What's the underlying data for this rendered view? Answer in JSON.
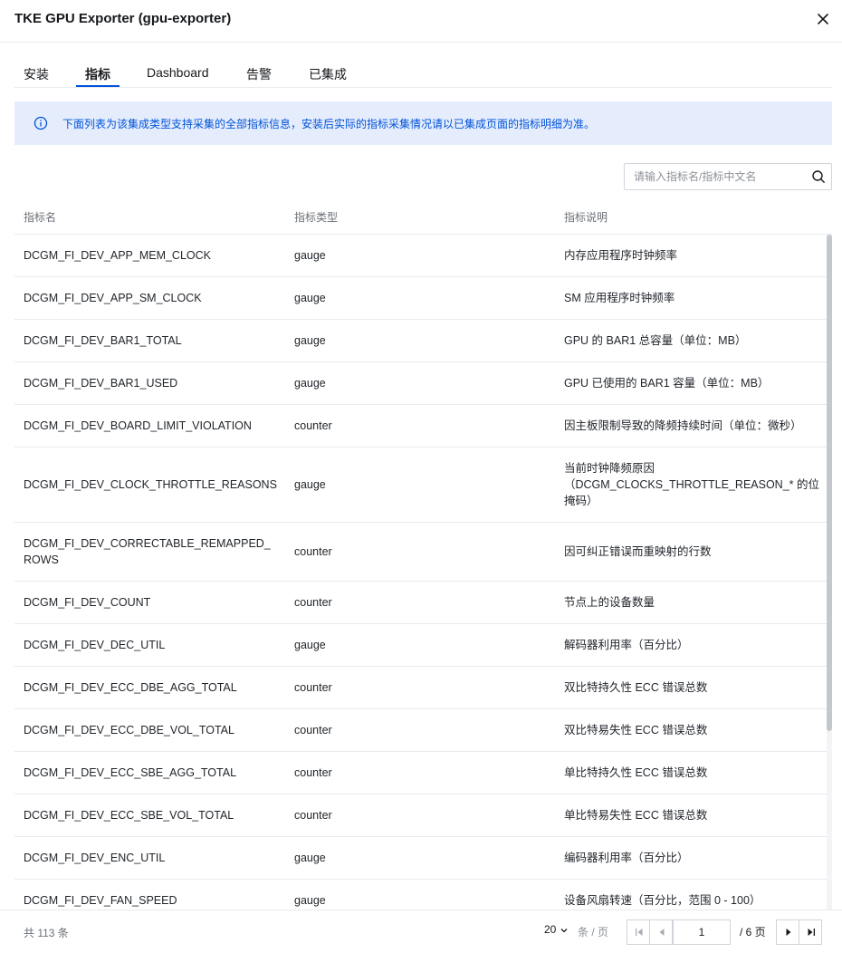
{
  "dialog": {
    "title": "TKE GPU Exporter (gpu-exporter)"
  },
  "tabs": [
    {
      "label": "安装"
    },
    {
      "label": "指标"
    },
    {
      "label": "Dashboard"
    },
    {
      "label": "告警"
    },
    {
      "label": "已集成"
    }
  ],
  "notice": {
    "text": "下面列表为该集成类型支持采集的全部指标信息，安装后实际的指标采集情况请以已集成页面的指标明细为准。"
  },
  "search": {
    "placeholder": "请输入指标名/指标中文名",
    "value": ""
  },
  "table": {
    "columns": [
      "指标名",
      "指标类型",
      "指标说明"
    ],
    "rows": [
      {
        "name": "DCGM_FI_DEV_APP_MEM_CLOCK",
        "type": "gauge",
        "desc": "内存应用程序时钟频率"
      },
      {
        "name": "DCGM_FI_DEV_APP_SM_CLOCK",
        "type": "gauge",
        "desc": "SM 应用程序时钟频率"
      },
      {
        "name": "DCGM_FI_DEV_BAR1_TOTAL",
        "type": "gauge",
        "desc": "GPU 的 BAR1 总容量（单位：MB）"
      },
      {
        "name": "DCGM_FI_DEV_BAR1_USED",
        "type": "gauge",
        "desc": "GPU 已使用的 BAR1 容量（单位：MB）"
      },
      {
        "name": "DCGM_FI_DEV_BOARD_LIMIT_VIOLATION",
        "type": "counter",
        "desc": "因主板限制导致的降频持续时间（单位：微秒）"
      },
      {
        "name": "DCGM_FI_DEV_CLOCK_THROTTLE_REASONS",
        "type": "gauge",
        "desc": "当前时钟降频原因（DCGM_CLOCKS_THROTTLE_REASON_* 的位掩码）"
      },
      {
        "name": "DCGM_FI_DEV_CORRECTABLE_REMAPPED_ROWS",
        "type": "counter",
        "desc": "因可纠正错误而重映射的行数"
      },
      {
        "name": "DCGM_FI_DEV_COUNT",
        "type": "counter",
        "desc": "节点上的设备数量"
      },
      {
        "name": "DCGM_FI_DEV_DEC_UTIL",
        "type": "gauge",
        "desc": "解码器利用率（百分比）"
      },
      {
        "name": "DCGM_FI_DEV_ECC_DBE_AGG_TOTAL",
        "type": "counter",
        "desc": "双比特持久性 ECC 错误总数"
      },
      {
        "name": "DCGM_FI_DEV_ECC_DBE_VOL_TOTAL",
        "type": "counter",
        "desc": "双比特易失性 ECC 错误总数"
      },
      {
        "name": "DCGM_FI_DEV_ECC_SBE_AGG_TOTAL",
        "type": "counter",
        "desc": "单比特持久性 ECC 错误总数"
      },
      {
        "name": "DCGM_FI_DEV_ECC_SBE_VOL_TOTAL",
        "type": "counter",
        "desc": "单比特易失性 ECC 错误总数"
      },
      {
        "name": "DCGM_FI_DEV_ENC_UTIL",
        "type": "gauge",
        "desc": "编码器利用率（百分比）"
      },
      {
        "name": "DCGM_FI_DEV_FAN_SPEED",
        "type": "gauge",
        "desc": "设备风扇转速（百分比，范围 0 - 100）"
      }
    ]
  },
  "pagination": {
    "total_text": "共 113 条",
    "page_size": "20",
    "per_page_text": "条 / 页",
    "current_page": "1",
    "total_pages_text": "/ 6 页"
  },
  "icons": {
    "close": "close-icon",
    "info": "info-circle-icon",
    "search": "search-icon"
  },
  "colors": {
    "accent": "#0052d9",
    "notice_bg": "#e5edfd"
  }
}
